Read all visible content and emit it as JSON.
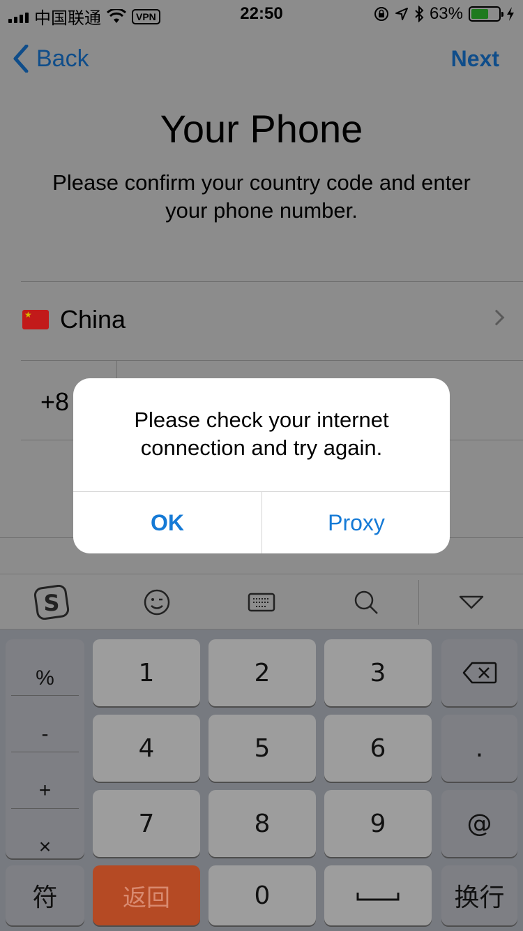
{
  "status_bar": {
    "carrier": "中国联通",
    "vpn": "VPN",
    "time": "22:50",
    "battery": "63%",
    "battery_level": 0.63
  },
  "nav": {
    "back_label": "Back",
    "next_label": "Next"
  },
  "page": {
    "title": "Your Phone",
    "subtitle": "Please confirm your country code and enter your phone number."
  },
  "country": {
    "name": "China",
    "code": "+8"
  },
  "alert": {
    "message": "Please check your internet connection and try again.",
    "ok_label": "OK",
    "proxy_label": "Proxy"
  },
  "keyboard": {
    "symbols": [
      "%",
      "-",
      "+",
      "×"
    ],
    "digits": [
      "1",
      "2",
      "3",
      "4",
      "5",
      "6",
      "7",
      "8",
      "9"
    ],
    "dot": ".",
    "at": "@",
    "fu": "符",
    "back_cn": "返回",
    "zero": "0",
    "enter_cn": "换行"
  },
  "colors": {
    "accent": "#157ad6",
    "nav_blue": "#0f4d8a",
    "return_key": "#b54a24"
  }
}
